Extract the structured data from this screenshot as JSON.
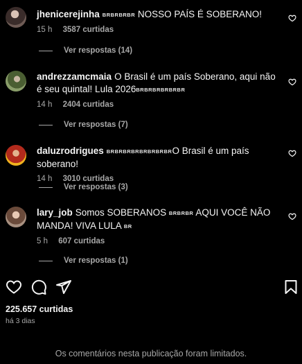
{
  "comments": [
    {
      "username": "jhenicerejinha",
      "flags": "BRBRBRBR",
      "text": "NOSSO PAÍS É SOBERANO!",
      "time": "15 h",
      "likes": "3587 curtidas",
      "replies": "Ver respostas (14)",
      "avatar_color": "#5a4a48"
    },
    {
      "username": "andrezzamcmaia",
      "flags_pre": "",
      "text": "O Brasil é um país Soberano, aqui não é seu quintal! Lula 2026",
      "flags": "BRBRBRBRBRBR",
      "time": "14 h",
      "likes": "2404 curtidas",
      "replies": "Ver respostas (7)",
      "avatar_color": "#5f7a4a"
    },
    {
      "username": "daluzrodrigues",
      "flags": "BRBRBRBRBRBRBRBR",
      "text": "O Brasil é um país soberano!",
      "time": "14 h",
      "likes": "3010 curtidas",
      "replies": "Ver respostas (3)",
      "avatar_color": "#c83a2a"
    },
    {
      "username": "lary_job",
      "text_a": "Somos SOBERANOS",
      "flags": "BRBRBR",
      "text_b": "AQUI VOCÊ NÃO MANDA! VIVA LULA",
      "flags_b": "BR",
      "time": "5 h",
      "likes": "607 curtidas",
      "replies": "Ver respostas (1)",
      "avatar_color": "#8a6a5a"
    }
  ],
  "icons": [
    "heart-icon",
    "comment-icon",
    "share-icon",
    "bookmark-icon"
  ],
  "post": {
    "likes": "225.657 curtidas",
    "time_ago": "há 3 dias"
  },
  "notice": "Os comentários nesta publicação foram limitados."
}
